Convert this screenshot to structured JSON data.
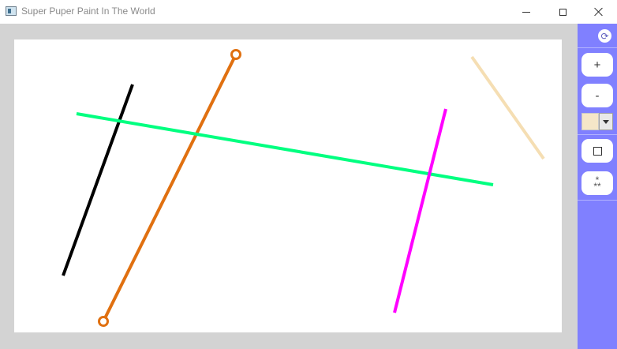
{
  "window": {
    "title": "Super Puper Paint In The World",
    "minimize_icon": "minimize-icon",
    "maximize_icon": "maximize-icon",
    "close_icon": "close-icon"
  },
  "toolbar": {
    "refresh_icon": "refresh-icon",
    "zoom_in_label": "+",
    "zoom_out_label": "-",
    "selected_color": "#f5e6c8",
    "shape_icon": "square-icon",
    "stars_icon": "stars-icon",
    "background": "#8080ff"
  },
  "canvas": {
    "background": "#ffffff",
    "lines": [
      {
        "name": "black-line",
        "color": "#000000"
      },
      {
        "name": "orange-line",
        "color": "#e07010",
        "endpoint_handles": true
      },
      {
        "name": "green-line",
        "color": "#00ff80"
      },
      {
        "name": "magenta-line",
        "color": "#ff00ff"
      },
      {
        "name": "beige-line",
        "color": "#f5deb3"
      }
    ]
  }
}
